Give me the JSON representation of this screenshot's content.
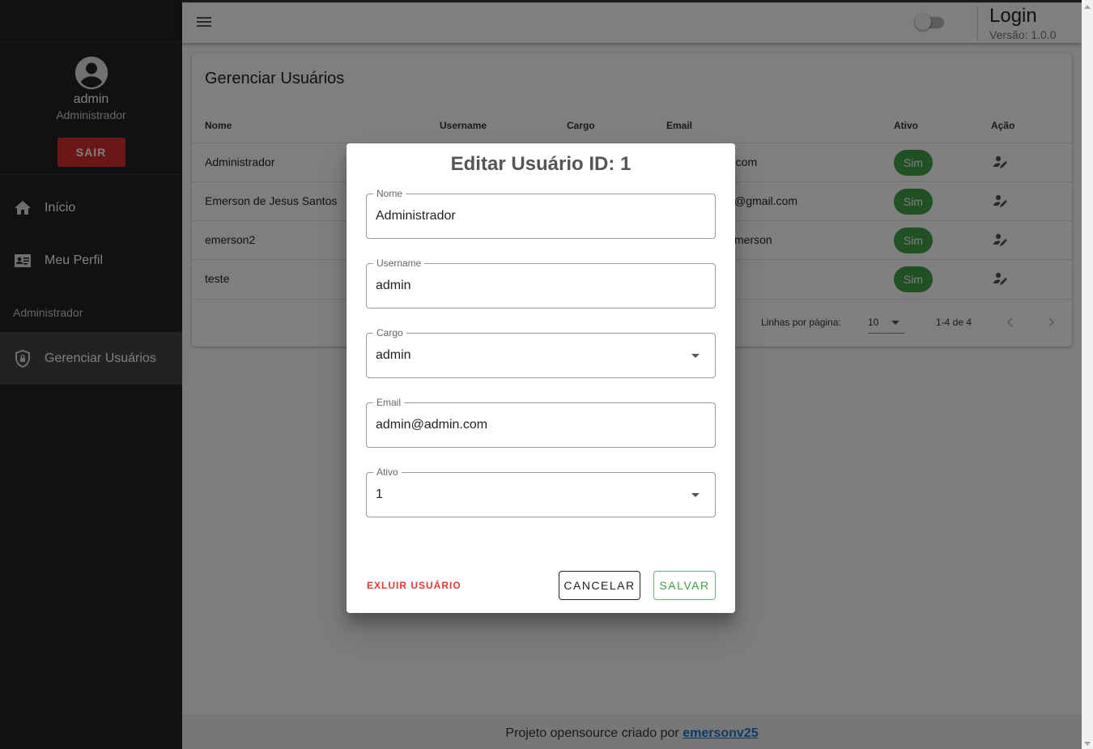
{
  "sidebar": {
    "user": {
      "name": "admin",
      "role": "Administrador"
    },
    "logout_label": "SAIR",
    "items": [
      {
        "label": "Início",
        "icon": "home-icon"
      },
      {
        "label": "Meu Perfil",
        "icon": "id-card-icon"
      }
    ],
    "section_label": "Administrador",
    "admin_items": [
      {
        "label": "Gerenciar Usuários",
        "icon": "shield-lock-icon",
        "active": true
      }
    ]
  },
  "header": {
    "title": "Login",
    "version": "Versão: 1.0.0"
  },
  "page": {
    "title": "Gerenciar Usuários",
    "table": {
      "columns": [
        "Nome",
        "Username",
        "Cargo",
        "Email",
        "Ativo",
        "Ação"
      ],
      "rows": [
        {
          "nome": "Administrador",
          "email_visible": "n.com",
          "ativo": "Sim"
        },
        {
          "nome": "Emerson de Jesus Santos",
          "email_visible": "@gmail.com",
          "ativo": "Sim"
        },
        {
          "nome": "emerson2",
          "email_visible": "merson",
          "ativo": "Sim"
        },
        {
          "nome": "teste",
          "email_visible": "",
          "ativo": "Sim"
        }
      ]
    },
    "pagination": {
      "rows_per_page_label": "Linhas por página:",
      "rows_per_page": "10",
      "range": "1-4 de 4"
    }
  },
  "footer": {
    "text": "Projeto opensource criado por",
    "link": "emersonv25"
  },
  "dialog": {
    "title": "Editar Usuário ID: 1",
    "fields": [
      {
        "label": "Nome",
        "value": "Administrador"
      },
      {
        "label": "Username",
        "value": "admin"
      },
      {
        "label": "Cargo",
        "value": "admin"
      },
      {
        "label": "Email",
        "value": "admin@admin.com"
      },
      {
        "label": "Ativo",
        "value": "1"
      }
    ],
    "delete_label": "EXLUIR USUÁRIO",
    "cancel_label": "CANCELAR",
    "save_label": "SALVAR"
  },
  "colors": {
    "accent_green": "#43a047",
    "danger_red": "#d32f2f",
    "sidebar_bg": "#222222",
    "link_blue": "#1976d2"
  }
}
